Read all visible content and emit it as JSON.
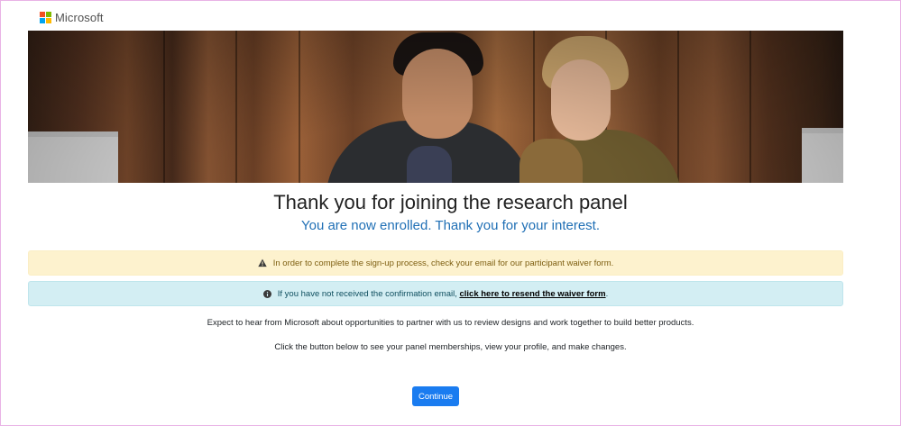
{
  "header": {
    "brand": "Microsoft",
    "logo_colors": [
      "#f25022",
      "#7fba00",
      "#00a4ef",
      "#ffb900"
    ]
  },
  "hero": {
    "image_alt": "Two people looking at a laptop screen and smiling"
  },
  "main": {
    "title": "Thank you for joining the research panel",
    "subtitle": "You are now enrolled. Thank you for your interest."
  },
  "alerts": {
    "warning": {
      "icon": "warning-triangle-icon",
      "text": "In order to complete the sign-up process, check your email for our participant waiver form."
    },
    "info": {
      "icon": "info-circle-icon",
      "text": "If you have not received the confirmation email, ",
      "link_text": "click here to resend the waiver form",
      "suffix": "."
    }
  },
  "body": {
    "paragraph1": "Expect to hear from Microsoft about opportunities to partner with us to review designs and work together to build better products.",
    "paragraph2": "Click the button below to see your panel memberships, view your profile, and make changes."
  },
  "actions": {
    "continue_label": "Continue"
  },
  "colors": {
    "accent": "#1a7cf0",
    "subtitle": "#1f6fb5",
    "warning_bg": "#fdf2ce",
    "info_bg": "#d3eef3"
  }
}
